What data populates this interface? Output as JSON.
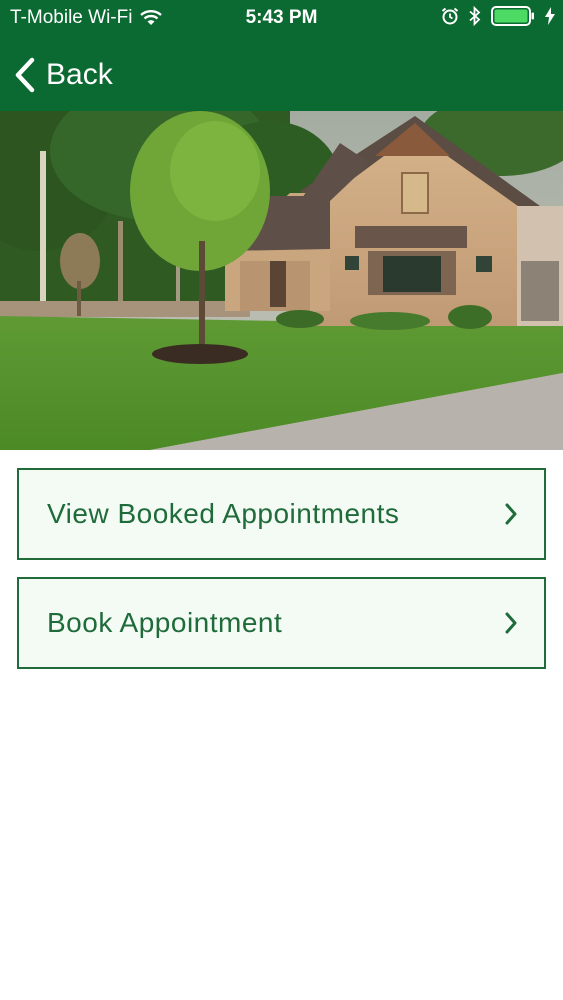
{
  "colors": {
    "header_bg": "#0b6a32",
    "accent": "#1f6b3a",
    "button_bg": "#f4fbf5",
    "battery": "#4cd964"
  },
  "status_bar": {
    "carrier": "T-Mobile Wi-Fi",
    "time": "5:43 PM",
    "icons": [
      "wifi-icon",
      "alarm-icon",
      "bluetooth-icon",
      "battery-icon",
      "charging-icon"
    ]
  },
  "nav": {
    "back_label": "Back",
    "back_icon": "chevron-left-icon"
  },
  "hero": {
    "image": "house-photo"
  },
  "menu": {
    "items": [
      {
        "label": "View Booked Appointments",
        "icon": "chevron-right-icon"
      },
      {
        "label": "Book Appointment",
        "icon": "chevron-right-icon"
      }
    ]
  }
}
